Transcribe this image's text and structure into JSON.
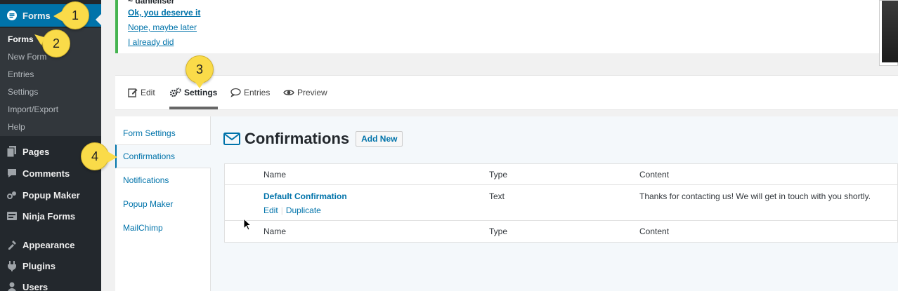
{
  "sidebar": {
    "active_menu": {
      "label": "Forms",
      "icon": "forms-icon"
    },
    "submenu": [
      {
        "label": "Forms",
        "current": true
      },
      {
        "label": "New Form",
        "current": false
      },
      {
        "label": "Entries",
        "current": false
      },
      {
        "label": "Settings",
        "current": false
      },
      {
        "label": "Import/Export",
        "current": false
      },
      {
        "label": "Help",
        "current": false
      }
    ],
    "menu": [
      {
        "label": "Pages",
        "icon": "pages-icon"
      },
      {
        "label": "Comments",
        "icon": "comments-icon"
      },
      {
        "label": "Popup Maker",
        "icon": "popup-maker-icon"
      },
      {
        "label": "Ninja Forms",
        "icon": "ninja-forms-icon"
      },
      {
        "label": "Appearance",
        "icon": "appearance-icon"
      },
      {
        "label": "Plugins",
        "icon": "plugins-icon"
      },
      {
        "label": "Users",
        "icon": "users-icon"
      }
    ],
    "colors": {
      "bg": "#23282d",
      "active": "#0073aa",
      "submenu_bg": "#32373c"
    }
  },
  "notice": {
    "author": "~ danieliser",
    "links": [
      "Ok, you deserve it",
      "Nope, maybe later",
      "I already did"
    ],
    "border_color": "#46b450"
  },
  "tabs": [
    {
      "label": "Edit",
      "icon": "edit-icon",
      "active": false
    },
    {
      "label": "Settings",
      "icon": "gears-icon",
      "active": true
    },
    {
      "label": "Entries",
      "icon": "comment-icon",
      "active": false
    },
    {
      "label": "Preview",
      "icon": "eye-icon",
      "active": false
    }
  ],
  "settings_nav": [
    {
      "label": "Form Settings",
      "active": false
    },
    {
      "label": "Confirmations",
      "active": true
    },
    {
      "label": "Notifications",
      "active": false
    },
    {
      "label": "Popup Maker",
      "active": false
    },
    {
      "label": "MailChimp",
      "active": false
    }
  ],
  "page": {
    "title": "Confirmations",
    "icon": "envelope-icon",
    "add_new_label": "Add New"
  },
  "table": {
    "columns": [
      "Name",
      "Type",
      "Content"
    ],
    "rows": [
      {
        "name": "Default Confirmation",
        "type": "Text",
        "content": "Thanks for contacting us! We will get in touch with you shortly.",
        "actions": [
          "Edit",
          "Duplicate"
        ]
      }
    ]
  },
  "callouts": [
    "1",
    "2",
    "3",
    "4"
  ]
}
